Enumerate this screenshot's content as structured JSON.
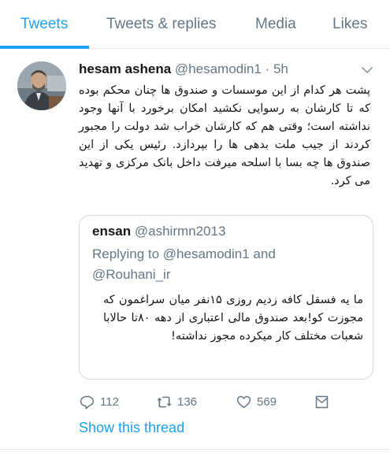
{
  "tabs": [
    {
      "label": "Tweets",
      "active": true
    },
    {
      "label": "Tweets & replies",
      "active": false
    },
    {
      "label": "Media",
      "active": false
    },
    {
      "label": "Likes",
      "active": false
    }
  ],
  "tweet": {
    "display_name": "hesam ashena",
    "handle": "@hesamodin1",
    "separator": "·",
    "time": "5h",
    "text": "پشت هر کدام از این موسسات و صندوق ها چنان محکم بوده که تا کارشان به رسوایی نکشید امکان برخورد با آنها وجود نداشته است؛ وقتی هم که کارشان خراب شد دولت را مجبور کردند از جیب ملت بدهی ها را بپردازد. رئیس یکی از این صندوق ها چه بسا با اسلحه میرفت داخل بانک مرکزی و تهدید می کرد.",
    "quoted": {
      "display_name": "ensan",
      "handle": "@ashirmn2013",
      "replying_prefix": "Replying to",
      "replying_to_1": "@hesamodin1",
      "replying_and": "and",
      "replying_to_2": "@Rouhani_ir",
      "text": "ما یه فسقل کافه زدیم روزی ۱۵نفر میان سراغمون که مجوزت کو!بعد صندوق مالی اعتباری از دهه ۸۰تا حالابا شعبات مختلف کار میکرده مجوز نداشته!"
    },
    "actions": {
      "reply_count": "112",
      "retweet_count": "136",
      "like_count": "569"
    },
    "show_thread": "Show this thread"
  },
  "colors": {
    "accent": "#1da1f2",
    "secondary_text": "#657786",
    "border": "#e1e8ed"
  },
  "icons": {
    "reply": "reply-icon",
    "retweet": "retweet-icon",
    "like": "heart-icon",
    "share": "share-icon",
    "caret": "chevron-down-icon"
  }
}
